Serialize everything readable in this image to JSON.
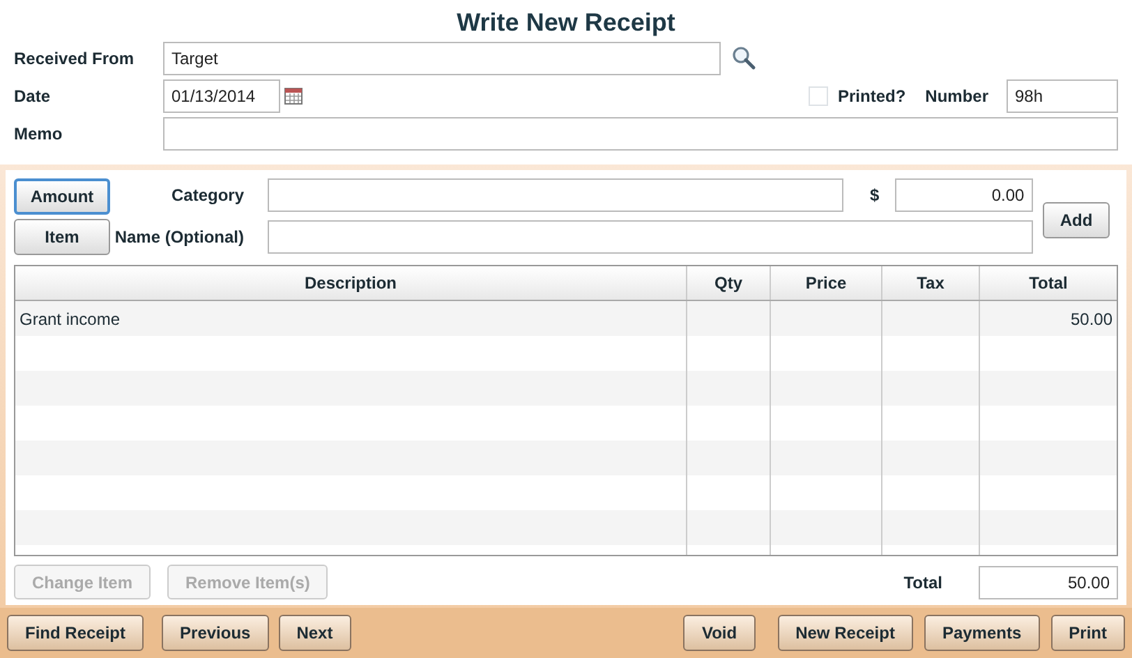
{
  "window": {
    "title": "Write New Receipt"
  },
  "header": {
    "received_from": {
      "label": "Received From",
      "value": "Target"
    },
    "date": {
      "label": "Date",
      "value": "01/13/2014"
    },
    "printed": {
      "label": "Printed?",
      "checked": false
    },
    "number": {
      "label": "Number",
      "value": "98h"
    },
    "memo": {
      "label": "Memo"
    }
  },
  "mode_toggle": [
    {
      "label": "Amount",
      "selected": true
    },
    {
      "label": "Item",
      "selected": false
    }
  ],
  "entry": {
    "category_label": "Category",
    "currency_label": "$",
    "amount": "0.00",
    "name_label": "Name (Optional)",
    "add_button": "Add"
  },
  "table": {
    "columns": [
      "Description",
      "Qty",
      "Price",
      "Tax",
      "Total"
    ],
    "rows": [
      [
        "Grant income",
        "",
        "",
        "",
        "50.00"
      ]
    ]
  },
  "item_buttons": [
    {
      "label": "Change Item",
      "disabled": true
    },
    {
      "label": "Remove Item(s)",
      "disabled": true
    }
  ],
  "total": {
    "label": "Total",
    "value": "50.00"
  },
  "footer_left": [
    "Find Receipt",
    "Previous",
    "Next"
  ],
  "footer_right": [
    "Void",
    "New Receipt",
    "Payments",
    "Print"
  ]
}
